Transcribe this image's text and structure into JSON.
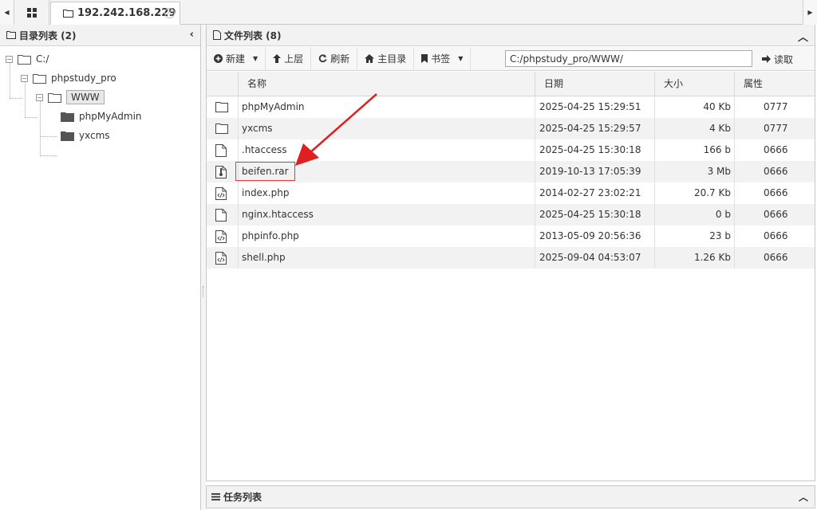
{
  "tabbar": {
    "host_label": "192.242.168.229"
  },
  "dir_panel": {
    "title": "目录列表 (2)",
    "tree": {
      "root": "C:/",
      "level1": "phpstudy_pro",
      "level2_selected": "WWW",
      "children": [
        "phpMyAdmin",
        "yxcms"
      ]
    }
  },
  "file_panel": {
    "title": "文件列表 (8)",
    "toolbar": {
      "new_label": "新建",
      "up_label": "上层",
      "refresh_label": "刷新",
      "home_label": "主目录",
      "bookmark_label": "书签",
      "path_value": "C:/phpstudy_pro/WWW/",
      "read_label": "读取"
    },
    "columns": {
      "name": "名称",
      "date": "日期",
      "size": "大小",
      "attr": "属性"
    },
    "rows": [
      {
        "icon": "folder-icon",
        "name": "phpMyAdmin",
        "date": "2025-04-25 15:29:51",
        "size": "40 Kb",
        "attr": "0777"
      },
      {
        "icon": "folder-icon",
        "name": "yxcms",
        "date": "2025-04-25 15:29:57",
        "size": "4 Kb",
        "attr": "0777"
      },
      {
        "icon": "file-icon",
        "name": ".htaccess",
        "date": "2025-04-25 15:30:18",
        "size": "166 b",
        "attr": "0666"
      },
      {
        "icon": "archive-icon",
        "name": "beifen.rar",
        "date": "2019-10-13 17:05:39",
        "size": "3 Mb",
        "attr": "0666"
      },
      {
        "icon": "code-file-icon",
        "name": "index.php",
        "date": "2014-02-27 23:02:21",
        "size": "20.7 Kb",
        "attr": "0666"
      },
      {
        "icon": "file-icon",
        "name": "nginx.htaccess",
        "date": "2025-04-25 15:30:18",
        "size": "0 b",
        "attr": "0666"
      },
      {
        "icon": "code-file-icon",
        "name": "phpinfo.php",
        "date": "2013-05-09 20:56:36",
        "size": "23 b",
        "attr": "0666"
      },
      {
        "icon": "code-file-icon",
        "name": "shell.php",
        "date": "2025-09-04 04:53:07",
        "size": "1.26 Kb",
        "attr": "0666"
      }
    ]
  },
  "task_panel": {
    "title": "任务列表"
  },
  "colors": {
    "annotation_red": "#e02020",
    "row_alt": "#f2f2f2"
  }
}
